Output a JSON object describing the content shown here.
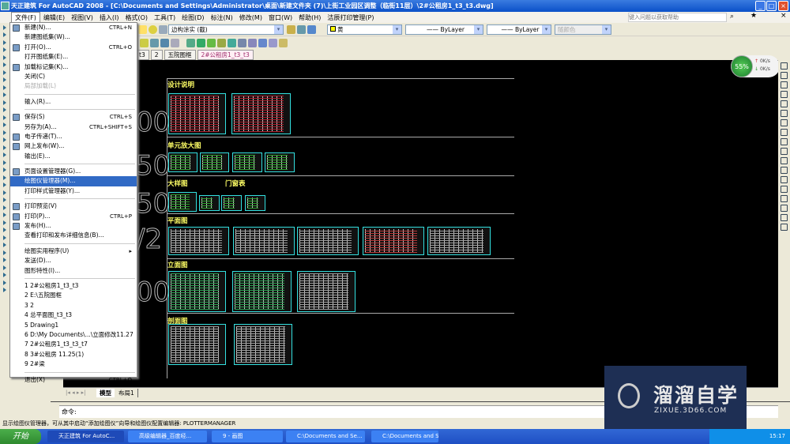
{
  "window": {
    "title": "天正建筑 For AutoCAD 2008 - [C:\\Documents and Settings\\Administrator\\桌面\\新建文件夹 (7)\\上街工业园区调整（临街11层）\\2#公租房1_t3_t3.dwg]",
    "help_placeholder": "键入问题以获取帮助"
  },
  "menubar": [
    "文件(F)",
    "编辑(E)",
    "视图(V)",
    "插入(I)",
    "格式(O)",
    "工具(T)",
    "绘图(D)",
    "标注(N)",
    "修改(M)",
    "窗口(W)",
    "帮助(H)",
    "洁辰打印管理(P)"
  ],
  "toolbar": {
    "layer": "边构涂实 (截)",
    "color": "黄",
    "linetype": "ByLayer",
    "lineweight": "ByLayer",
    "plotstyle": "随颜色"
  },
  "doc_tabs": [
    "t3",
    "2",
    "五院图框",
    "2#公租房1_t3_t3"
  ],
  "file_menu": [
    {
      "label": "新建(N)...",
      "shortcut": "CTRL+N",
      "icon": "new-icon"
    },
    {
      "label": "新建图纸集(W)..."
    },
    {
      "label": "打开(O)...",
      "shortcut": "CTRL+O",
      "icon": "open-icon"
    },
    {
      "label": "打开图纸集(E)..."
    },
    {
      "label": "加载标记集(K)...",
      "icon": "markup-icon"
    },
    {
      "label": "关闭(C)"
    },
    {
      "label": "局部加载(L)",
      "disabled": true
    },
    {
      "sep": true
    },
    {
      "label": "输入(R)..."
    },
    {
      "sep": true
    },
    {
      "label": "保存(S)",
      "shortcut": "CTRL+S",
      "icon": "save-icon"
    },
    {
      "label": "另存为(A)...",
      "shortcut": "CTRL+SHIFT+S"
    },
    {
      "label": "电子传递(T)...",
      "icon": "etransmit-icon"
    },
    {
      "label": "网上发布(W)...",
      "icon": "publish-web-icon"
    },
    {
      "label": "输出(E)..."
    },
    {
      "sep": true
    },
    {
      "label": "页面设置管理器(G)...",
      "icon": "page-setup-icon"
    },
    {
      "label": "绘图仪管理器(M)...",
      "highlighted": true
    },
    {
      "label": "打印样式管理器(Y)..."
    },
    {
      "sep": true
    },
    {
      "label": "打印预览(V)",
      "icon": "preview-icon"
    },
    {
      "label": "打印(P)...",
      "shortcut": "CTRL+P",
      "icon": "print-icon"
    },
    {
      "label": "发布(H)...",
      "icon": "publish-icon"
    },
    {
      "label": "查看打印和发布详细信息(B)..."
    },
    {
      "sep": true
    },
    {
      "label": "绘图实用程序(U)",
      "submenu": true
    },
    {
      "label": "发送(D)..."
    },
    {
      "label": "图形特性(I)..."
    },
    {
      "sep": true
    },
    {
      "label": "1 2#公租房1_t3_t3"
    },
    {
      "label": "2 E:\\五院图框"
    },
    {
      "label": "3 2"
    },
    {
      "label": "4 总平面图_t3_t3"
    },
    {
      "label": "5 Drawing1"
    },
    {
      "label": "6 D:\\My Documents\\...\\立面修改11.27"
    },
    {
      "label": "7 2#公租房1_t3_t3_t7"
    },
    {
      "label": "8 3#公租房  11.25(1)"
    },
    {
      "label": "9 2#梁"
    },
    {
      "sep": true
    },
    {
      "label": "退出(X)",
      "shortcut": "CTRL+Q"
    }
  ],
  "drawing": {
    "sections": [
      "设计说明",
      "单元放大图",
      "大样图",
      "门窗表",
      "平面图",
      "立面图",
      "剖面图"
    ],
    "axis_labels": [
      "00",
      "50",
      "50",
      "/2",
      "00"
    ]
  },
  "net_widget": {
    "percent": "55%",
    "up": "0K/s",
    "down": "0K/s"
  },
  "layout_tabs": [
    "模型",
    "布局1"
  ],
  "command": {
    "prompt": "命令:"
  },
  "status_text": "显示绘图仪管理器，可从其中启动“添加绘图仪”向导和绘图仪配置编辑器:   PLOTTERMANAGER",
  "watermark": {
    "name": "溜溜自学",
    "url": "ZIXUE.3D66.COM"
  },
  "taskbar": {
    "start": "开始",
    "tasks": [
      "天正建筑 For AutoC...",
      "高级编辑器_百度经...",
      "9 - 画图",
      "C:\\Documents and Se...",
      "C:\\Documents and Se..."
    ],
    "clock": "15:17"
  },
  "colors": {
    "accent": "#316ac5",
    "titlebar": "#0a50c8",
    "drawing_bg": "#000000",
    "section_title": "#ffff66",
    "thumb_border": "#33e0e0"
  }
}
